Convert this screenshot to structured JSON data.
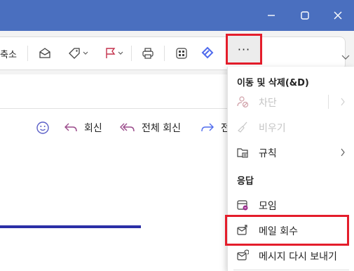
{
  "ribbon": {
    "shrink_label": "축소",
    "more_label": "···"
  },
  "actions": {
    "reply": "회신",
    "reply_all": "전체 회신",
    "forward_partial": "전"
  },
  "menu": {
    "section_move_delete": "이동 및 삭제(&D)",
    "block": "차단",
    "sweep": "비우기",
    "rules": "규칙",
    "section_respond": "응답",
    "meeting": "모임",
    "recall": "메일 회수",
    "resend": "메시지 다시 보내기"
  },
  "colors": {
    "titlebar": "#4a6fbf",
    "highlight": "#e41d2b",
    "accent_line": "#2b2fa6"
  }
}
